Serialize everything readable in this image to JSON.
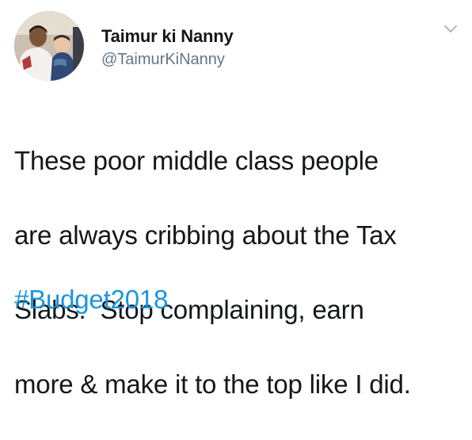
{
  "tweet": {
    "display_name": "Taimur ki Nanny",
    "handle": "@TaimurKiNanny",
    "text_lines": [
      "These poor middle class people",
      "are always cribbing about the Tax",
      "Slabs.  Stop complaining, earn",
      "more & make it to the top like I did."
    ],
    "hashtag": "#Budget2018",
    "menu_icon": "chevron-down-icon",
    "avatar_icon": "profile-photo"
  },
  "colors": {
    "text": "#14171a",
    "secondary": "#657786",
    "link": "#1b95e0",
    "caret": "#aab8c2"
  }
}
